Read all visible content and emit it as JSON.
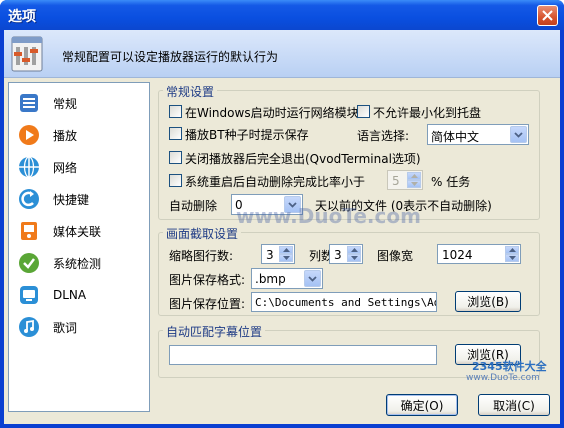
{
  "window": {
    "title": "选项",
    "header_text": "常规配置可以设定播放器运行的默认行为"
  },
  "nav": {
    "items": [
      {
        "label": "常规",
        "icon": "general-icon",
        "color": "#3a78c8"
      },
      {
        "label": "播放",
        "icon": "play-icon",
        "color": "#f07a1a"
      },
      {
        "label": "网络",
        "icon": "network-icon",
        "color": "#2b8fd6"
      },
      {
        "label": "快捷键",
        "icon": "shortcut-icon",
        "color": "#2b8fd6"
      },
      {
        "label": "媒体关联",
        "icon": "media-association-icon",
        "color": "#f07a1a"
      },
      {
        "label": "系统检测",
        "icon": "system-check-icon",
        "color": "#5aa636"
      },
      {
        "label": "DLNA",
        "icon": "dlna-icon",
        "color": "#2b8fd6"
      },
      {
        "label": "歌词",
        "icon": "lyrics-icon",
        "color": "#2b8fd6"
      }
    ]
  },
  "general": {
    "title": "常规设置",
    "run_network_on_startup": "在Windows启动时运行网络模块",
    "no_minimize_to_tray": "不允许最小化到托盘",
    "bt_seed_prompt": "播放BT种子时提示保存",
    "language_label": "语言选择:",
    "language_value": "简体中文",
    "exit_completely": "关闭播放器后完全退出(QvodTerminal选项)",
    "auto_delete_on_restart": "系统重启后自动删除完成比率小于",
    "ratio_value": "5",
    "ratio_unit": "% 任务",
    "auto_delete_label": "自动删除",
    "auto_delete_value": "0",
    "auto_delete_suffix": "天以前的文件 (0表示不自动删除)"
  },
  "capture": {
    "title": "画面截取设置",
    "thumb_rows_label": "缩略图行数:",
    "thumb_rows_value": "3",
    "cols_label": "列数:",
    "cols_value": "3",
    "width_label": "图像宽",
    "width_value": "1024",
    "format_label": "图片保存格式:",
    "format_value": ".bmp",
    "path_label": "图片保存位置:",
    "path_value": "C:\\Documents and Settings\\Admi",
    "browse_label": "浏览(B)"
  },
  "subtitle": {
    "title": "自动匹配字幕位置",
    "path_value": "",
    "browse_label": "浏览(R)"
  },
  "buttons": {
    "ok": "确定(O)",
    "cancel": "取消(C)"
  },
  "watermarks": {
    "center": "www.DuoTe.com",
    "corner_brand": "2345软件大全",
    "corner_url": "www.DuoTe.com"
  }
}
